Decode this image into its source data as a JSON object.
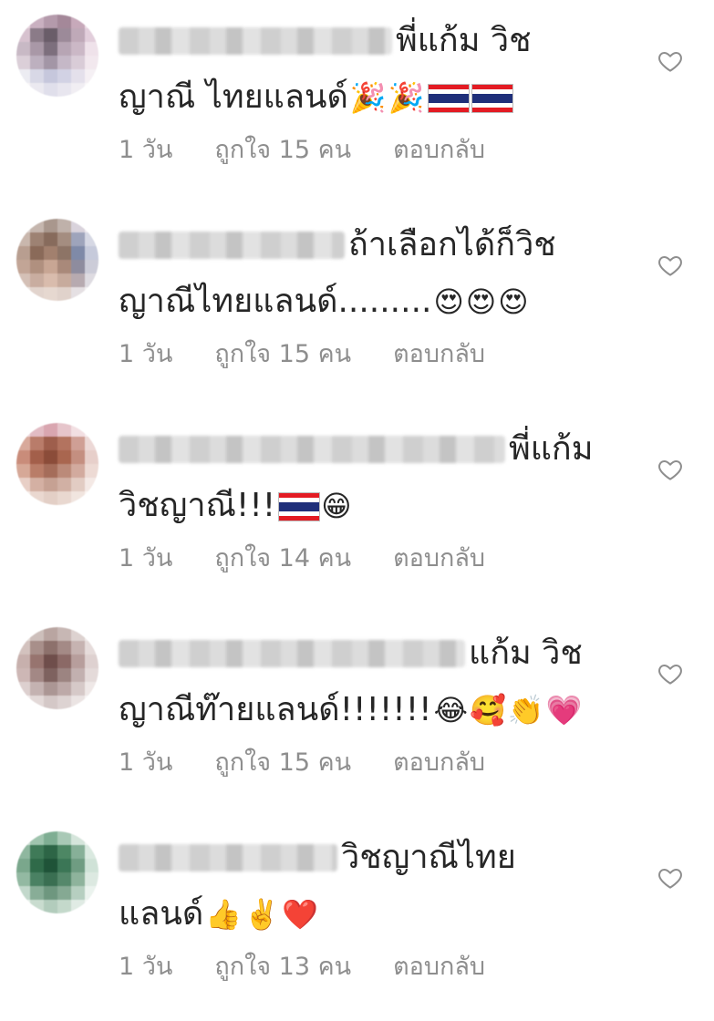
{
  "comments": [
    {
      "text_line1": "พี่แก้ม วิช",
      "text_line2": "ญาณี ไทยแลนด์",
      "emojis": [
        "party-popper",
        "party-popper",
        "thai-flag",
        "thai-flag"
      ],
      "time": "1 วัน",
      "likes": "ถูกใจ 15 คน",
      "reply": "ตอบกลับ",
      "avatar_colors": [
        "#e8d6df",
        "#c9b0c0",
        "#b49aab",
        "#a48899",
        "#c7a9ba",
        "#eddde6",
        "#d7c2cf",
        "#8b7b88",
        "#6a5d69",
        "#9c8a99",
        "#bfa9b8",
        "#e2cedb",
        "#c8b9c5",
        "#a998a7",
        "#7d6f7d",
        "#b7a5b4",
        "#cbb8c6",
        "#efe2ea",
        "#dbcfd8",
        "#bdb0bf",
        "#a396a6",
        "#c5b8c7",
        "#d9ccd7",
        "#f2e8ee",
        "#ececf2",
        "#d8d8e6",
        "#c6c7dc",
        "#d2d2e4",
        "#e4e0eb",
        "#f5f0f4",
        "#f7f4f6",
        "#ebe9f0",
        "#e0dfeb",
        "#e8e6ef",
        "#f1eef3",
        "#fbf9fa"
      ]
    },
    {
      "text_line1": "ถ้าเลือกได้ก็วิช",
      "text_line2": "ญาณีไทยแลนด์.........",
      "emojis": [
        "heart-eyes",
        "heart-eyes",
        "heart-eyes"
      ],
      "time": "1 วัน",
      "likes": "ถูกใจ 15 คน",
      "reply": "ตอบกลับ",
      "avatar_colors": [
        "#dcd3cf",
        "#c5b6ae",
        "#a9978d",
        "#bfb1aa",
        "#d9d3dc",
        "#eeeaf0",
        "#c9b7ad",
        "#9d8273",
        "#876b5c",
        "#a48d80",
        "#9ea4bb",
        "#d6d8e4",
        "#b89e90",
        "#8a6a59",
        "#a2806e",
        "#8d7466",
        "#7f8aa8",
        "#c6cadb",
        "#c2a596",
        "#b0907f",
        "#c8a694",
        "#a9897a",
        "#8e8c9e",
        "#ccccd8",
        "#d4c0b6",
        "#c9ada0",
        "#d9bcad",
        "#c7ab9d",
        "#b7aab0",
        "#dedbe1",
        "#ece4e0",
        "#e2d4cd",
        "#e6d8d0",
        "#e0d2cb",
        "#e5e0e3",
        "#f3f1f2"
      ]
    },
    {
      "text_line1": "พี่แก้ม",
      "text_line2": "วิชญาณี!!!",
      "emojis": [
        "thai-flag",
        "grinning"
      ],
      "time": "1 วัน",
      "likes": "ถูกใจ 14 คน",
      "reply": "ตอบกลับ",
      "avatar_colors": [
        "#efd9dd",
        "#e2bcc4",
        "#d9a6b0",
        "#e6c5cb",
        "#f2dfe2",
        "#f8eef0",
        "#d8a99b",
        "#b97c6a",
        "#9e5e4c",
        "#b3735f",
        "#cf9f95",
        "#ecd8d6",
        "#c98c7a",
        "#a35f4a",
        "#8b4c39",
        "#a9664f",
        "#c48f80",
        "#e7cfca",
        "#d6a897",
        "#b97d68",
        "#a56d5a",
        "#bb8a79",
        "#d2aa9e",
        "#eddad4",
        "#e8cfc6",
        "#d4b0a3",
        "#c6a193",
        "#d1b0a4",
        "#e2ccc3",
        "#f4e9e5",
        "#f5ebe7",
        "#ead8d0",
        "#e3cfc6",
        "#e9d8d0",
        "#f1e5df",
        "#fbf5f2"
      ]
    },
    {
      "text_line1": "แก้ม วิช",
      "text_line2": "ญาณีท๊ายแลนด์!!!!!!!",
      "emojis": [
        "tears-of-joy",
        "smiling-hearts",
        "clapping-hands",
        "growing-heart"
      ],
      "time": "1 วัน",
      "likes": "ถูกใจ 15 คน",
      "reply": "ตอบกลับ",
      "avatar_colors": [
        "#e2d9d6",
        "#cdbfbb",
        "#b9a5a1",
        "#c7b7b4",
        "#ddd2d0",
        "#efe9e8",
        "#d3c2be",
        "#a88f8a",
        "#8d716c",
        "#a48a86",
        "#c6b3b1",
        "#e6dcdb",
        "#c7b0ad",
        "#97746f",
        "#6f4e4b",
        "#8b6966",
        "#b79e9c",
        "#ded1d0",
        "#cdb7b5",
        "#a38885",
        "#7e625f",
        "#9c8481",
        "#c2b0af",
        "#e4dad9",
        "#ddd0cf",
        "#c4b2b1",
        "#ab9694",
        "#bda9a8",
        "#d6c9c8",
        "#efe8e7",
        "#f2ecec",
        "#e3d9d8",
        "#d4c8c7",
        "#ddd3d2",
        "#ebe4e3",
        "#f8f5f5"
      ]
    },
    {
      "text_line1": "วิชญาณีไทย",
      "text_line2": "แลนด์",
      "emojis": [
        "thumbs-up",
        "victory-hand",
        "red-heart"
      ],
      "time": "1 วัน",
      "likes": "ถูกใจ 13 คน",
      "reply": "ตอบกลับ",
      "avatar_colors": [
        "#cfe0d6",
        "#9fc4ae",
        "#7fae93",
        "#a9c9b6",
        "#d5e5db",
        "#eef5f1",
        "#8fb79f",
        "#3f7a58",
        "#2d6546",
        "#4d8764",
        "#87b098",
        "#dae9e0",
        "#7aa78c",
        "#2f6a49",
        "#1f5338",
        "#3b7656",
        "#6f9c82",
        "#cfe2d7",
        "#93b9a2",
        "#4a8163",
        "#3a6f52",
        "#55886b",
        "#8eb39c",
        "#dce9e1",
        "#c2d8cb",
        "#88ad97",
        "#6e977f",
        "#85a993",
        "#b6cfc0",
        "#ebf3ee",
        "#e9f1ec",
        "#c9dccf",
        "#b2ccbc",
        "#c4d9cb",
        "#e0ebe4",
        "#f7faf8"
      ]
    }
  ],
  "icons": {
    "like": "heart-outline-icon"
  },
  "colors": {
    "text": "#262626",
    "meta": "#8e8e8e",
    "flag_red": "#e31b23",
    "flag_blue": "#1f2f7a"
  }
}
